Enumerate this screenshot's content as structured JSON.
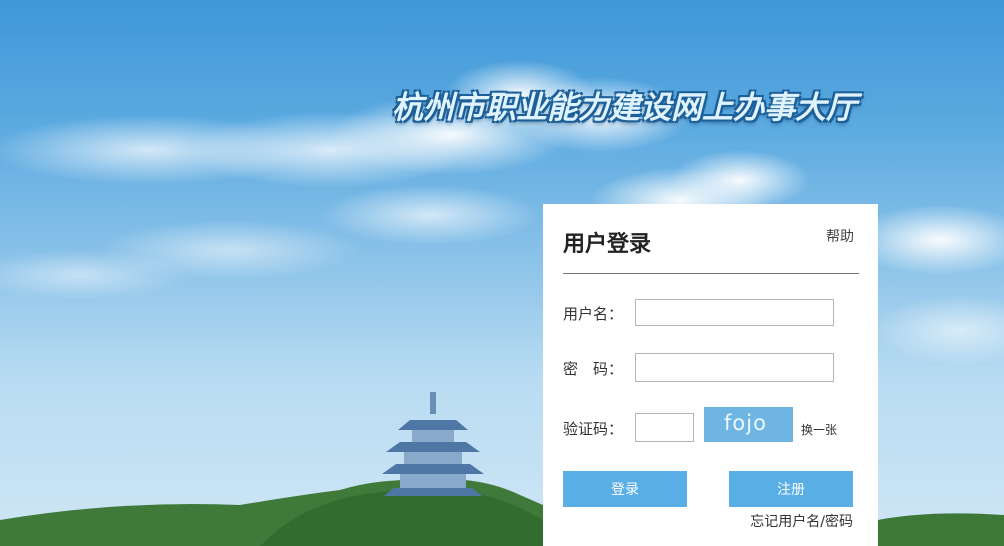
{
  "site": {
    "title": "杭州市职业能力建设网上办事大厅"
  },
  "login": {
    "title": "用户登录",
    "help": "帮助",
    "username_label": "用户名：",
    "username_value": "",
    "password_label": "密　码：",
    "password_value": "",
    "captcha_label": "验证码：",
    "captcha_value": "",
    "captcha_text": "fojo",
    "refresh_captcha": "换一张",
    "login_button": "登录",
    "register_button": "注册",
    "forgot_link": "忘记用户名/密码"
  },
  "colors": {
    "sky_top": "#3f97d8",
    "button": "#5aaee6",
    "captcha_bg": "#6fb5e4"
  }
}
